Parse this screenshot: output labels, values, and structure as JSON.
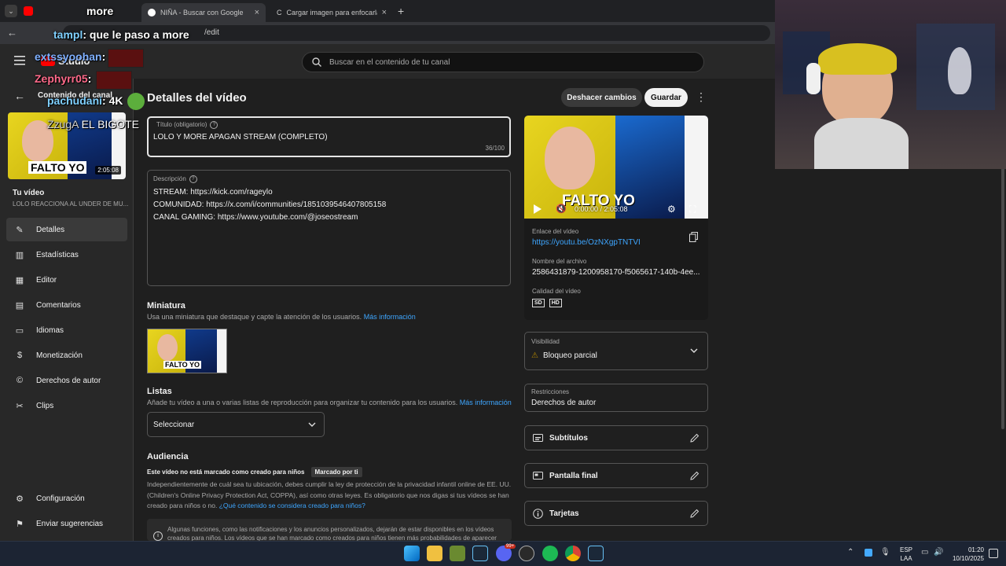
{
  "browser": {
    "tabs": [
      {
        "label": "NIÑA - Buscar con Google"
      },
      {
        "label": "Cargar imagen para enfocarla y"
      }
    ],
    "new_tab": "+",
    "address": "/edit"
  },
  "stream_chat": [
    {
      "user": "",
      "text": "more"
    },
    {
      "user": "tampl",
      "text": ": que le paso a more"
    },
    {
      "user": "extssyoohan",
      "text": ":"
    },
    {
      "user": "Zephyrr05",
      "text": ":"
    },
    {
      "user": "pachudani",
      "text": ": 4K"
    },
    {
      "user": "ZzugA",
      "text": "EL BIGOTE"
    }
  ],
  "studio": {
    "logo": "Studio",
    "search_placeholder": "Buscar en el contenido de tu canal"
  },
  "sidebar": {
    "back_label": "Contenido del canal",
    "thumb_duration": "2:05:08",
    "thumb_overlay_text": "FALTO YO",
    "your_video_label": "Tu vídeo",
    "your_video_title": "LOLO REACCIONA AL UNDER DE MU...",
    "items": [
      {
        "label": "Detalles",
        "icon": "pencil-icon"
      },
      {
        "label": "Estadísticas",
        "icon": "analytics-icon"
      },
      {
        "label": "Editor",
        "icon": "editor-icon"
      },
      {
        "label": "Comentarios",
        "icon": "comments-icon"
      },
      {
        "label": "Idiomas",
        "icon": "subtitles-icon"
      },
      {
        "label": "Monetización",
        "icon": "dollar-icon"
      },
      {
        "label": "Derechos de autor",
        "icon": "copyright-icon"
      },
      {
        "label": "Clips",
        "icon": "scissors-icon"
      }
    ],
    "bottom_items": [
      {
        "label": "Configuración",
        "icon": "gear-icon"
      },
      {
        "label": "Enviar sugerencias",
        "icon": "feedback-icon"
      }
    ]
  },
  "details": {
    "page_title": "Detalles del vídeo",
    "undo_label": "Deshacer cambios",
    "save_label": "Guardar",
    "title_field_label": "Título (obligatorio)",
    "title_value": "LOLO Y MORE APAGAN STREAM (COMPLETO)",
    "title_counter": "36/100",
    "description_label": "Descripción",
    "description_lines": [
      "STREAM: https://kick.com/rageylo",
      "COMUNIDAD: https://x.com/i/communities/1851039546407805158",
      "CANAL GAMING: https://www.youtube.com/@joseostream"
    ],
    "thumbnail_heading": "Miniatura",
    "thumbnail_desc": "Usa una miniatura que destaque y capte la atención de los usuarios.",
    "more_info": "Más información",
    "lists_heading": "Listas",
    "lists_desc": "Añade tu vídeo a una o varias listas de reproducción para organizar tu contenido para los usuarios.",
    "lists_select": "Seleccionar",
    "audience_heading": "Audiencia",
    "audience_status": "Este vídeo no está marcado como creado para niños",
    "audience_badge": "Marcado por ti",
    "audience_text": "Independientemente de cuál sea tu ubicación, debes cumplir la ley de protección de la privacidad infantil online de EE. UU. (Children's Online Privacy Protection Act, COPPA), así como otras leyes. Es obligatorio que nos digas si tus vídeos se han creado para niños o no.",
    "audience_link": "¿Qué contenido se considera creado para niños?",
    "info_text": "Algunas funciones, como las notificaciones y los anuncios personalizados, dejarán de estar disponibles en los vídeos creados para niños. Los vídeos que se han marcado como creados para niños tienen más probabilidades de aparecer"
  },
  "preview": {
    "time": "0:00:00 / 2:05:08",
    "overlay_text": "FALTO YO",
    "link_label": "Enlace del vídeo",
    "link": "https://youtu.be/OzNXgpTNTVI",
    "filename_label": "Nombre del archivo",
    "filename": "2586431879-1200958170-f5065617-140b-4ee...",
    "quality_label": "Calidad del vídeo",
    "quality_badges": [
      "SD",
      "HD"
    ],
    "visibility_label": "Visibilidad",
    "visibility_value": "Bloqueo parcial",
    "restrictions_label": "Restricciones",
    "restrictions_value": "Derechos de autor",
    "rows": [
      {
        "label": "Subtítulos",
        "icon": "subtitles-icon"
      },
      {
        "label": "Pantalla final",
        "icon": "end-screen-icon"
      },
      {
        "label": "Tarjetas",
        "icon": "info-icon"
      }
    ]
  },
  "taskbar": {
    "lang": "ESP",
    "layout": "LAA",
    "time": "01:20",
    "date": "10/10/2025",
    "notification_count": "99+"
  }
}
